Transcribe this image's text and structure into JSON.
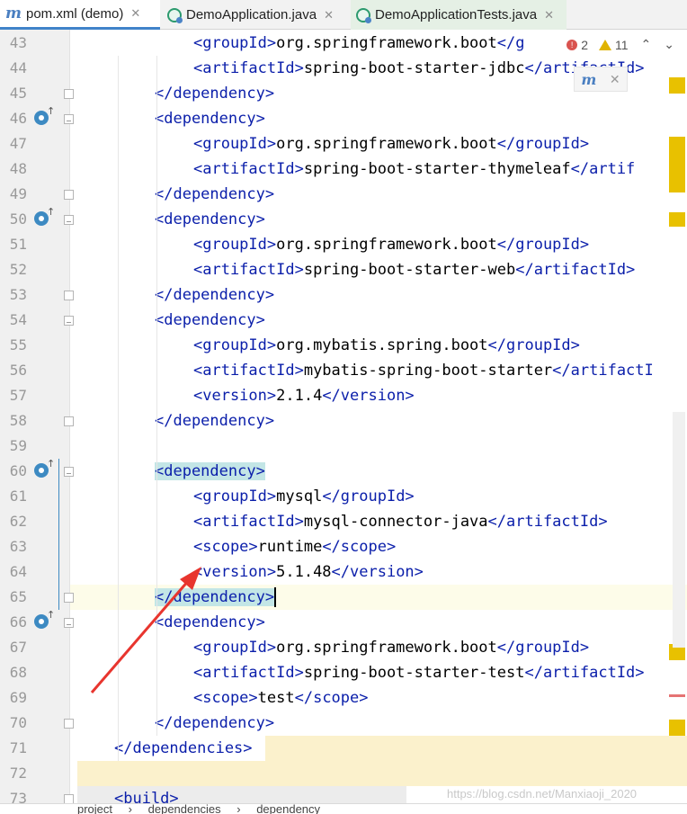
{
  "tabs": [
    {
      "label": "pom.xml (demo)",
      "icon": "maven-icon",
      "icon_text": "m",
      "active": true
    },
    {
      "label": "DemoApplication.java",
      "icon": "java-class-icon",
      "active": false
    },
    {
      "label": "DemoApplicationTests.java",
      "icon": "java-class-icon",
      "active": false
    }
  ],
  "inspection": {
    "errors": "2",
    "warnings": "11"
  },
  "maven_popup": {
    "icon_text": "m"
  },
  "lines": [
    {
      "n": "43",
      "code": "<groupId>org.springframework.boot</g"
    },
    {
      "n": "44",
      "code": "<artifactId>spring-boot-starter-jdbc</artifactId>"
    },
    {
      "n": "45",
      "code": "</dependency>"
    },
    {
      "n": "46",
      "code": "<dependency>"
    },
    {
      "n": "47",
      "code": "<groupId>org.springframework.boot</groupId>"
    },
    {
      "n": "48",
      "code": "<artifactId>spring-boot-starter-thymeleaf</artif"
    },
    {
      "n": "49",
      "code": "</dependency>"
    },
    {
      "n": "50",
      "code": "<dependency>"
    },
    {
      "n": "51",
      "code": "<groupId>org.springframework.boot</groupId>"
    },
    {
      "n": "52",
      "code": "<artifactId>spring-boot-starter-web</artifactId>"
    },
    {
      "n": "53",
      "code": "</dependency>"
    },
    {
      "n": "54",
      "code": "<dependency>"
    },
    {
      "n": "55",
      "code": "<groupId>org.mybatis.spring.boot</groupId>"
    },
    {
      "n": "56",
      "code": "<artifactId>mybatis-spring-boot-starter</artifactI"
    },
    {
      "n": "57",
      "code": "<version>2.1.4</version>"
    },
    {
      "n": "58",
      "code": "</dependency>"
    },
    {
      "n": "59",
      "code": ""
    },
    {
      "n": "60",
      "code": "<dependency>"
    },
    {
      "n": "61",
      "code": "<groupId>mysql</groupId>"
    },
    {
      "n": "62",
      "code": "<artifactId>mysql-connector-java</artifactId>"
    },
    {
      "n": "63",
      "code": "<scope>runtime</scope>"
    },
    {
      "n": "64",
      "code": "<version>5.1.48</version>"
    },
    {
      "n": "65",
      "code": "</dependency>"
    },
    {
      "n": "66",
      "code": "<dependency>"
    },
    {
      "n": "67",
      "code": "<groupId>org.springframework.boot</groupId>"
    },
    {
      "n": "68",
      "code": "<artifactId>spring-boot-starter-test</artifactId>"
    },
    {
      "n": "69",
      "code": "<scope>test</scope>"
    },
    {
      "n": "70",
      "code": "</dependency>"
    },
    {
      "n": "71",
      "code": "</dependencies>"
    },
    {
      "n": "72",
      "code": ""
    },
    {
      "n": "73",
      "code": "<build>"
    }
  ],
  "breadcrumbs": [
    "project",
    "dependencies",
    "dependency"
  ],
  "watermark": "https://blog.csdn.net/Manxiaoji_2020",
  "colors": {
    "tag": "#0a1eaa",
    "highlight": "#c3e6e6",
    "annotation_arrow": "#e8352e"
  }
}
